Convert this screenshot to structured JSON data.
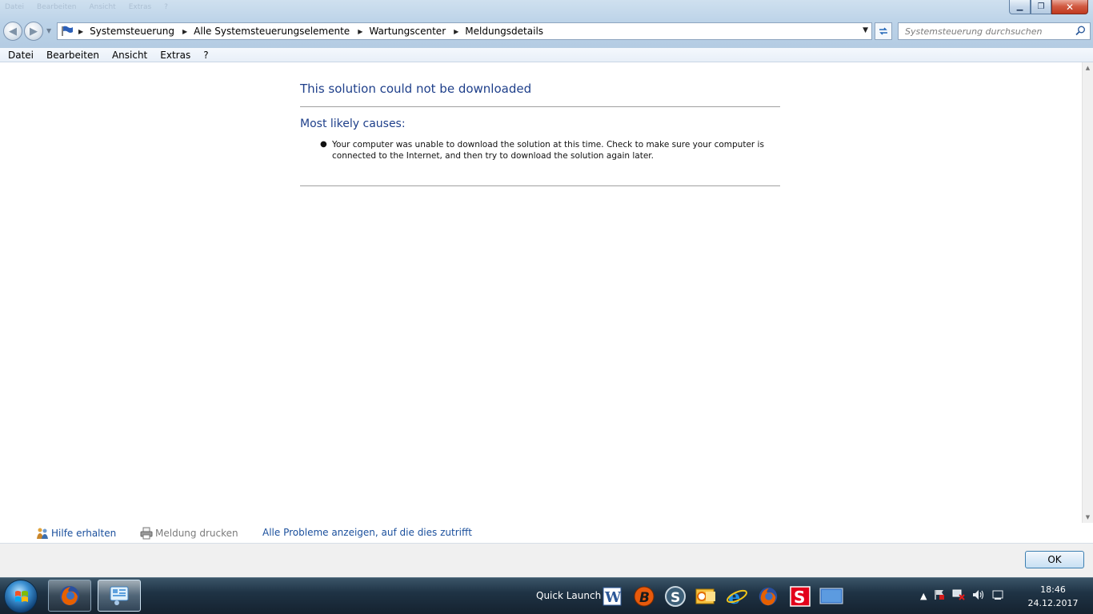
{
  "window": {
    "ghost_menu": [
      "Datei",
      "Bearbeiten",
      "Ansicht",
      "Extras",
      "?"
    ],
    "controls": {
      "minimize": "▁",
      "maximize": "❐",
      "close": "✕"
    }
  },
  "nav": {
    "back": "◀",
    "forward": "▶",
    "breadcrumbs": [
      "Systemsteuerung",
      "Alle Systemsteuerungselemente",
      "Wartungscenter",
      "Meldungsdetails"
    ],
    "search_placeholder": "Systemsteuerung durchsuchen"
  },
  "menubar": [
    "Datei",
    "Bearbeiten",
    "Ansicht",
    "Extras",
    "?"
  ],
  "content": {
    "title": "This solution could not be downloaded",
    "causes_heading": "Most likely causes:",
    "causes": [
      "Your computer was unable to download the solution at this time. Check to make sure your computer is connected to the Internet, and then try to download the solution again later."
    ]
  },
  "links": {
    "help": "Hilfe erhalten",
    "print": "Meldung drucken",
    "show_all": "Alle Probleme anzeigen, auf die dies zutrifft"
  },
  "buttons": {
    "ok": "OK"
  },
  "taskbar": {
    "quick_launch_label": "Quick Launch",
    "quick_launch_icons": [
      "word-icon",
      "b-app-icon",
      "s-app-icon",
      "outlook-icon",
      "internet-explorer-icon",
      "firefox-icon",
      "s-red-app-icon",
      "desktop-icon"
    ],
    "clock_time": "18:46",
    "clock_date": "24.12.2017"
  },
  "colors": {
    "heading_blue": "#1e3f8a",
    "link_blue": "#1a4f9c"
  }
}
